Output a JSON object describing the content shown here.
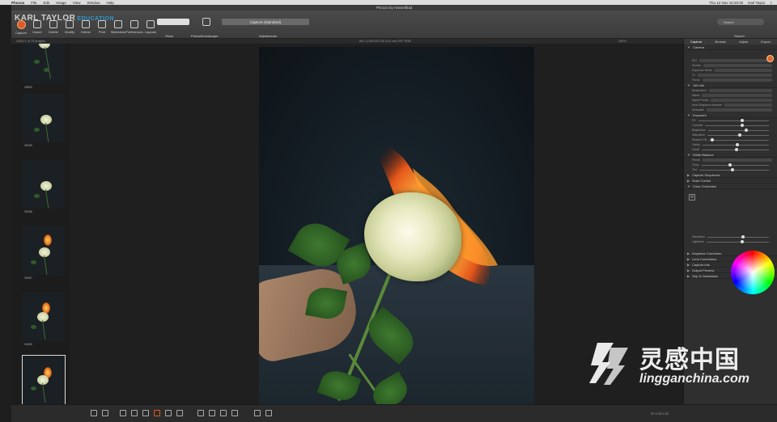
{
  "menubar": {
    "app": "Phocus",
    "items": [
      "File",
      "Edit",
      "Image",
      "View",
      "Window",
      "Help"
    ],
    "clock": "Thu 12 Nov 18:30:02",
    "user": "Karl Taylor"
  },
  "window": {
    "title": "Phocus by Hasselblad"
  },
  "brand": {
    "name": "KARL TAYLOR",
    "suffix": "EDUCATION"
  },
  "toolbar": {
    "buttons": [
      "Capture",
      "Import",
      "Delete",
      "Modify",
      "Delete",
      "Print",
      "Slideshow",
      "Preferences",
      "Layouts"
    ],
    "show_label": "Show",
    "orientation_label": "Portrait/Landscape",
    "adjustment_style": "Capture (Standard)",
    "adjustments_label": "Adjustments",
    "search_placeholder": "Search",
    "search_label": "Search"
  },
  "infobar": {
    "left": "1/200   1 of 73 Images",
    "center": "f/8.0  1/200  ISO 50  22.0 mm  FFF  RGB",
    "right": "100%"
  },
  "thumbnails": [
    {
      "caption": "35500",
      "fire": false
    },
    {
      "caption": "35499",
      "fire": false
    },
    {
      "caption": "35498",
      "fire": false
    },
    {
      "caption": "35497",
      "fire": true
    },
    {
      "caption": "35495",
      "fire": true
    },
    {
      "caption": "35492",
      "fire": true,
      "selected": true
    }
  ],
  "tools": {
    "tabs": [
      "Capture",
      "Browse",
      "Adjust",
      "Export"
    ],
    "active_tab": "Capture",
    "sections": [
      "Camera",
      "Job Info",
      "Exposure",
      "White Balance",
      "Capture Sequencer",
      "Scan Control",
      "Color Correction",
      "Keystone Correction",
      "Lens Corrections",
      "Capture Info",
      "Output Preview",
      "Grip & Orientation"
    ],
    "camera_rows": [
      "ISO",
      "Shutter",
      "Exposure Mode",
      "Tv",
      "Focus"
    ],
    "jobinfo_rows": [
      "Destination",
      "Name",
      "Name Preset",
      "Next Sequence Number",
      "Metadata"
    ],
    "exposure_rows": [
      "EV",
      "Contrast",
      "Brightness",
      "Saturation",
      "Shadow Fill",
      "Clarity",
      "Detail"
    ],
    "wb_rows": [
      "Preset",
      "Temp",
      "Tint"
    ],
    "cc_rows": [
      "Saturation",
      "Lightness"
    ]
  },
  "bottombar": {
    "right": "37    0    23    0    22"
  },
  "site": {
    "cn": "灵感中国",
    "en": "lingganchina.com"
  },
  "colors": {
    "accent": "#e05a25",
    "brand": "#2fa4e7"
  }
}
